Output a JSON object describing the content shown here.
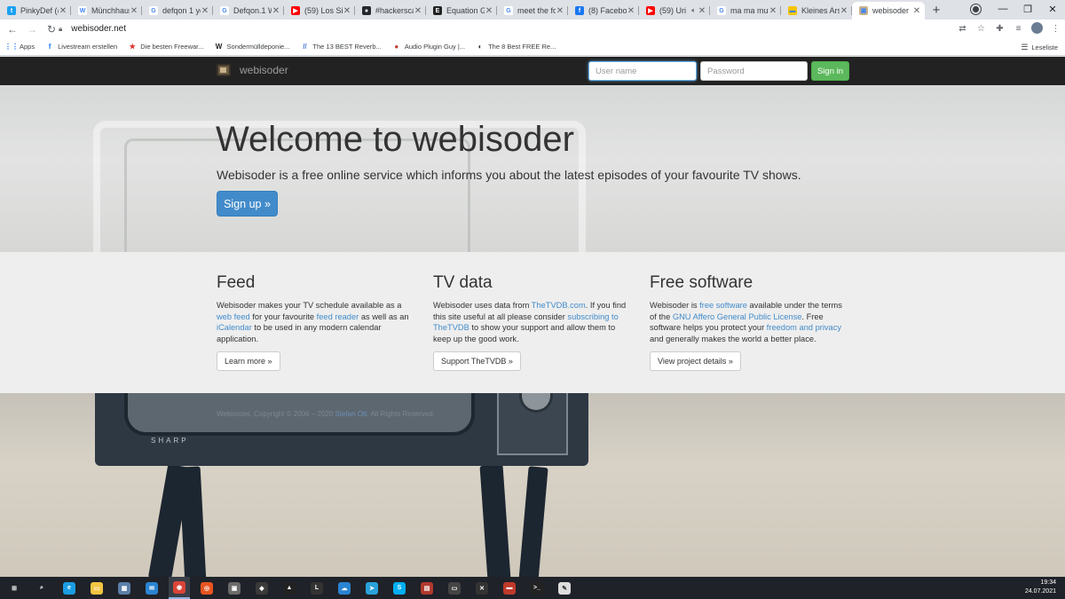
{
  "browser": {
    "tabs": [
      {
        "title": "PinkyDef (@",
        "icon": "twitter-icon",
        "color": "#1da1f2",
        "glyph": "t"
      },
      {
        "title": "Münchhaus",
        "icon": "wikipedia-icon",
        "color": "#ffffff",
        "glyph": "W"
      },
      {
        "title": "defqon 1 yo",
        "icon": "google-icon",
        "color": "#ffffff",
        "glyph": "G"
      },
      {
        "title": "Defqon.1 W",
        "icon": "google-icon",
        "color": "#ffffff",
        "glyph": "G"
      },
      {
        "title": "(59) Los Sin",
        "icon": "youtube-icon",
        "color": "#ff0000",
        "glyph": "▶"
      },
      {
        "title": "#hackersca",
        "icon": "github-icon",
        "color": "#24292e",
        "glyph": "●"
      },
      {
        "title": "Equation Gr",
        "icon": "site-icon",
        "color": "#222222",
        "glyph": "E"
      },
      {
        "title": "meet the fo",
        "icon": "google-icon",
        "color": "#ffffff",
        "glyph": "G"
      },
      {
        "title": "(8) Faceboo",
        "icon": "facebook-icon",
        "color": "#1877f2",
        "glyph": "f"
      },
      {
        "title": "(59) Uri",
        "icon": "youtube-icon",
        "color": "#ff0000",
        "glyph": "▶"
      },
      {
        "title": "ma ma mut",
        "icon": "google-icon",
        "color": "#ffffff",
        "glyph": "G"
      },
      {
        "title": "Kleines Arsc",
        "icon": "site-icon",
        "color": "#f5c400",
        "glyph": "▬"
      },
      {
        "title": "webisoder",
        "icon": "webisoder-icon",
        "color": "#c8b38c",
        "glyph": "▣"
      }
    ],
    "url": "webisoder.net",
    "bookmarks": [
      {
        "label": "Apps",
        "icon": "apps-grid-icon",
        "glyph": "⋮⋮",
        "color": "#1a73e8"
      },
      {
        "label": "Livestream erstellen",
        "icon": "facebook-icon",
        "glyph": "f",
        "color": "#1877f2"
      },
      {
        "label": "Die besten Freewar...",
        "icon": "star-icon",
        "glyph": "★",
        "color": "#d93025"
      },
      {
        "label": "Sondermülldeponie...",
        "icon": "wikipedia-icon",
        "glyph": "W",
        "color": "#202124"
      },
      {
        "label": "The 13 BEST Reverb...",
        "icon": "site-icon",
        "glyph": "//",
        "color": "#4a7bd0"
      },
      {
        "label": "Audio Plugin Guy |...",
        "icon": "site-icon",
        "glyph": "●",
        "color": "#c0392b"
      },
      {
        "label": "The 8 Best FREE Re...",
        "icon": "site-icon",
        "glyph": "◐",
        "color": "#333333"
      }
    ],
    "reading_list": "Leseliste"
  },
  "site": {
    "brand": "webisoder",
    "login": {
      "username_placeholder": "User name",
      "password_placeholder": "Password",
      "signin_label": "Sign in"
    },
    "hero": {
      "title": "Welcome to webisoder",
      "lead": "Webisoder is a free online service which informs you about the latest episodes of your favourite TV shows.",
      "signup_label": "Sign up »"
    },
    "features": [
      {
        "heading": "Feed",
        "parts": [
          {
            "t": "Webisoder makes your TV schedule available as a "
          },
          {
            "t": "web feed",
            "link": true
          },
          {
            "t": " for your favourite "
          },
          {
            "t": "feed reader",
            "link": true
          },
          {
            "t": " as well as an "
          },
          {
            "t": "iCalendar",
            "link": true
          },
          {
            "t": " to be used in any modern calendar application."
          }
        ],
        "button": "Learn more »"
      },
      {
        "heading": "TV data",
        "parts": [
          {
            "t": "Webisoder uses data from "
          },
          {
            "t": "TheTVDB.com",
            "link": true
          },
          {
            "t": ". If you find this site useful at all please consider "
          },
          {
            "t": "subscribing to TheTVDB",
            "link": true
          },
          {
            "t": " to show your support and allow them to keep up the good work."
          }
        ],
        "button": "Support TheTVDB »"
      },
      {
        "heading": "Free software",
        "parts": [
          {
            "t": "Webisoder is "
          },
          {
            "t": "free software",
            "link": true
          },
          {
            "t": " available under the terms of the "
          },
          {
            "t": "GNU Affero General Public License",
            "link": true
          },
          {
            "t": ". Free software helps you protect your "
          },
          {
            "t": "freedom and privacy",
            "link": true
          },
          {
            "t": " and generally makes the world a better place."
          }
        ],
        "button": "View project details »"
      }
    ],
    "footer": {
      "prefix": "Webisoder, Copyright © 2006 – 2020 ",
      "author": "Stefan Ott",
      "suffix": ". All Rights Reserved."
    },
    "tv_brand": "SHARP"
  },
  "taskbar": {
    "apps": [
      {
        "icon": "windows-start-icon",
        "glyph": "⊞",
        "color": "#ffffff"
      },
      {
        "icon": "search-icon",
        "glyph": "⌕",
        "color": "#ffffff"
      },
      {
        "icon": "edge-icon",
        "glyph": "e",
        "color": "#1b9de2"
      },
      {
        "icon": "file-explorer-icon",
        "glyph": "▭",
        "color": "#f4c542"
      },
      {
        "icon": "store-icon",
        "glyph": "▦",
        "color": "#5a7fa8"
      },
      {
        "icon": "mail-icon",
        "glyph": "✉",
        "color": "#2a84d2"
      },
      {
        "icon": "chrome-icon",
        "glyph": "◉",
        "color": "#db4437"
      },
      {
        "icon": "ubuntu-icon",
        "glyph": "◎",
        "color": "#e95420"
      },
      {
        "icon": "app-icon",
        "glyph": "▣",
        "color": "#6b6b6b"
      },
      {
        "icon": "app-icon",
        "glyph": "◆",
        "color": "#3a3a3a"
      },
      {
        "icon": "inkscape-icon",
        "glyph": "▲",
        "color": "#222222"
      },
      {
        "icon": "live-icon",
        "glyph": "L",
        "color": "#333333"
      },
      {
        "icon": "onedrive-icon",
        "glyph": "☁",
        "color": "#2a84d2"
      },
      {
        "icon": "telegram-icon",
        "glyph": "➤",
        "color": "#2aa1da"
      },
      {
        "icon": "skype-icon",
        "glyph": "S",
        "color": "#00aff0"
      },
      {
        "icon": "app-icon",
        "glyph": "▤",
        "color": "#b03a2e"
      },
      {
        "icon": "app-icon",
        "glyph": "▭",
        "color": "#444444"
      },
      {
        "icon": "app-icon",
        "glyph": "✕",
        "color": "#333333"
      },
      {
        "icon": "app-icon",
        "glyph": "▬",
        "color": "#c0392b"
      },
      {
        "icon": "terminal-icon",
        "glyph": ">_",
        "color": "#222222"
      },
      {
        "icon": "notepad-icon",
        "glyph": "✎",
        "color": "#dddddd"
      }
    ],
    "time": "19:34",
    "date": "24.07.2021"
  }
}
